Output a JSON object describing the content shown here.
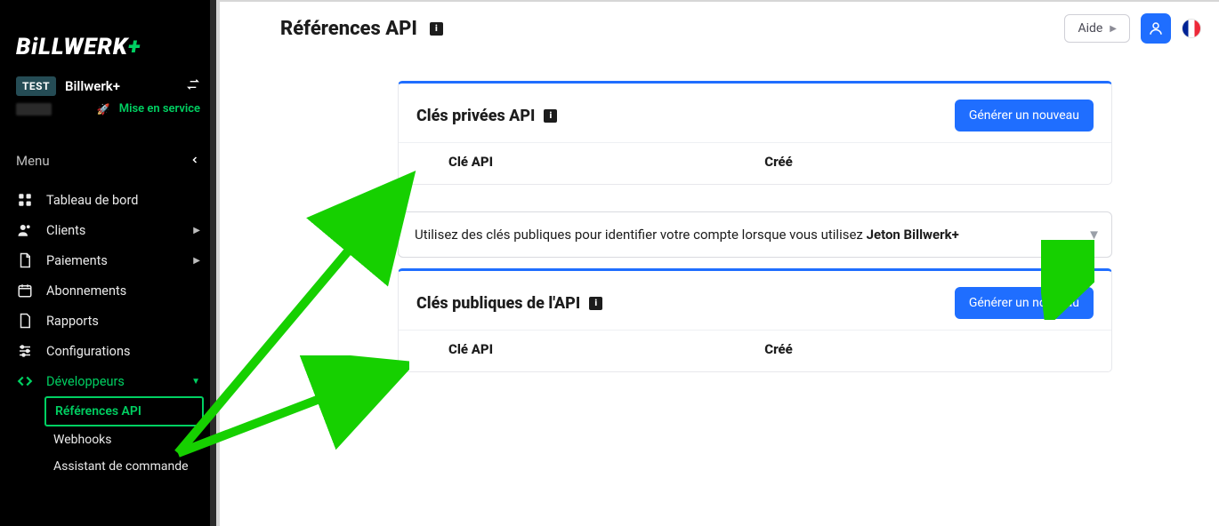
{
  "brand": {
    "name": "BiLLWERK",
    "plus": "+"
  },
  "org": {
    "badge": "TEST",
    "name": "Billwerk+",
    "go_live": "Mise en service"
  },
  "menu_header": "Menu",
  "sidebar": {
    "items": [
      {
        "icon": "dashboard",
        "label": "Tableau de bord",
        "arrow": false
      },
      {
        "icon": "clients",
        "label": "Clients",
        "arrow": true
      },
      {
        "icon": "payments",
        "label": "Paiements",
        "arrow": true
      },
      {
        "icon": "subs",
        "label": "Abonnements",
        "arrow": false
      },
      {
        "icon": "reports",
        "label": "Rapports",
        "arrow": false
      },
      {
        "icon": "config",
        "label": "Configurations",
        "arrow": false
      },
      {
        "icon": "dev",
        "label": "Développeurs",
        "arrow": true,
        "active": true
      }
    ],
    "dev_sub": [
      {
        "label": "Références API",
        "selected": true
      },
      {
        "label": "Webhooks"
      },
      {
        "label": "Assistant de commande"
      }
    ]
  },
  "header": {
    "title": "Références API",
    "help_label": "Aide"
  },
  "cards": {
    "private": {
      "title": "Clés privées API",
      "button": "Générer un nouveau",
      "col_key": "Clé API",
      "col_created": "Créé"
    },
    "public_info": {
      "text_before": "Utilisez des clés publiques pour identifier votre compte lorsque vous utilisez ",
      "bold": "Jeton Billwerk+"
    },
    "public": {
      "title": "Clés publiques de l'API",
      "button": "Générer un nouveau",
      "col_key": "Clé API",
      "col_created": "Créé"
    }
  }
}
